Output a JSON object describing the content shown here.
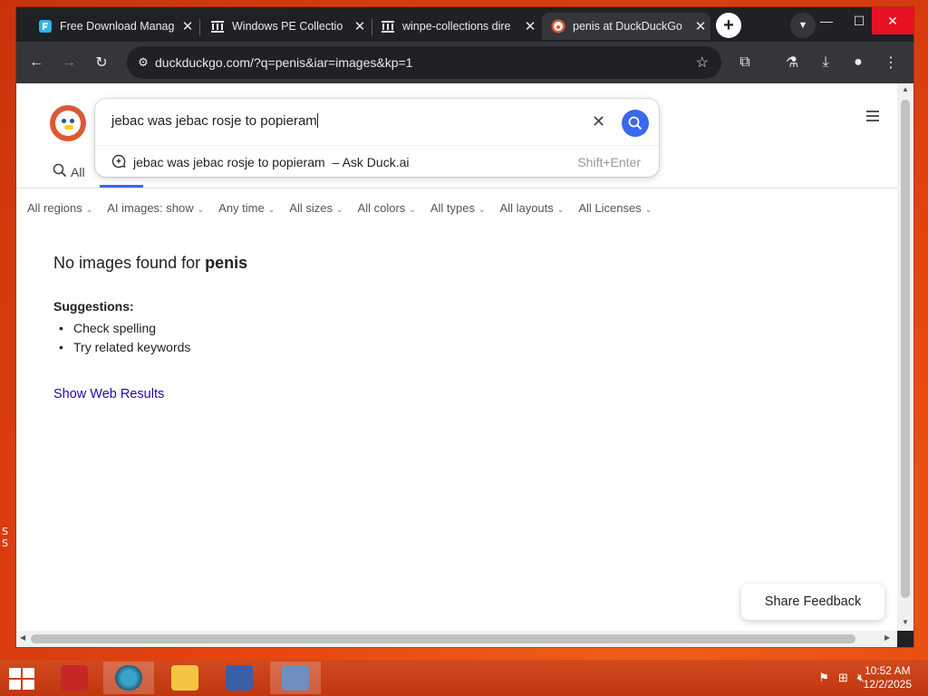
{
  "browser": {
    "tabs": [
      {
        "title": "Free Download Manag",
        "active": false,
        "favicon": "fdm-icon"
      },
      {
        "title": "Windows PE Collectio",
        "active": false,
        "favicon": "archive-org-icon"
      },
      {
        "title": "winpe-collections dire",
        "active": false,
        "favicon": "archive-org-icon"
      },
      {
        "title": "penis at DuckDuckGo",
        "active": true,
        "favicon": "duckduckgo-icon"
      }
    ],
    "new_tab_label": "+",
    "url": "duckduckgo.com/?q=penis&iar=images&kp=1"
  },
  "search": {
    "query": "jebac was jebac rosje to popieram",
    "suggestion": "jebac was jebac rosje to popieram",
    "suggestion_suffix": "– Ask Duck.ai",
    "shortcut_hint": "Shift+Enter"
  },
  "nav": {
    "all_label": "All"
  },
  "filters": [
    "All regions",
    "AI images: show",
    "Any time",
    "All sizes",
    "All colors",
    "All types",
    "All layouts",
    "All Licenses"
  ],
  "results": {
    "no_images_prefix": "No images found for",
    "no_images_term": "penis",
    "suggestions_title": "Suggestions:",
    "suggestions": [
      "Check spelling",
      "Try related keywords"
    ],
    "show_web_results": "Show Web Results"
  },
  "feedback_label": "Share Feedback",
  "taskbar": {
    "time": "10:52 AM",
    "date": "12/2/2025"
  },
  "colors": {
    "accent_blue": "#3969ef",
    "ddg_orange": "#de5833",
    "link": "#1a0dab",
    "desktop": "#e8450f"
  }
}
